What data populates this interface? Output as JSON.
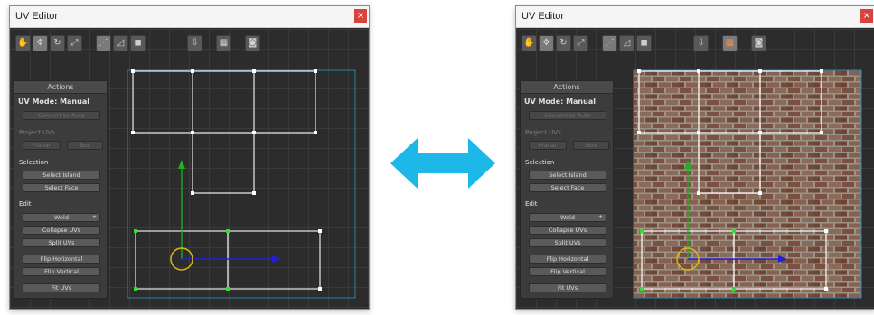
{
  "left_window": {
    "title": "UV Editor",
    "close_glyph": "×",
    "texture_preview_active": false
  },
  "right_window": {
    "title": "UV Editor",
    "close_glyph": "×",
    "texture_preview_active": true
  },
  "toolbar": {
    "buttons": [
      {
        "icon": "hand-icon",
        "glyph": "✋"
      },
      {
        "icon": "move-icon",
        "glyph": "✥"
      },
      {
        "icon": "rotate-icon",
        "glyph": "↻"
      },
      {
        "icon": "scale-icon",
        "glyph": "⤢"
      },
      {
        "icon": "vertex-select-icon",
        "glyph": "⋰"
      },
      {
        "icon": "edge-select-icon",
        "glyph": "◿"
      },
      {
        "icon": "face-select-icon",
        "glyph": "◼"
      },
      {
        "icon": "uv-export-icon",
        "glyph": "⇩"
      },
      {
        "icon": "texture-preview-icon",
        "glyph": "▦"
      },
      {
        "icon": "screenshot-icon",
        "glyph": "◙"
      }
    ]
  },
  "actions_panel": {
    "header": "Actions",
    "uv_mode_label": "UV Mode: Manual",
    "convert_to_auto": "Convert to Auto",
    "project_uvs_label": "Project UVs",
    "planar": "Planar",
    "box": "Box",
    "selection_label": "Selection",
    "select_island": "Select Island",
    "select_face": "Select Face",
    "edit_label": "Edit",
    "weld": "Weld",
    "weld_caret": "+",
    "collapse_uvs": "Collapse UVs",
    "split_uvs": "Split UVs",
    "flip_horizontal": "Flip Horizontal",
    "flip_vertical": "Flip Vertical",
    "fit_uvs": "Fit UVs"
  },
  "colors": {
    "arrow": "#1eb8e8",
    "uv_lines": "#e8e8e8",
    "selected_vertex": "#2fdc3a",
    "texture_bounds": "#2c7fb0",
    "gizmo_x": "#2020d8",
    "gizmo_y": "#22b022",
    "gizmo_circle": "#d8b818",
    "brick": "#7a5040",
    "mortar": "#9a9488"
  }
}
